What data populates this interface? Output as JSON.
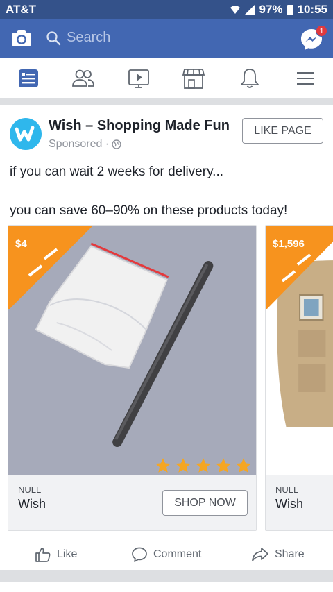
{
  "status": {
    "carrier": "AT&T",
    "battery": "97%",
    "time": "10:55"
  },
  "search": {
    "placeholder": "Search"
  },
  "messenger": {
    "badge": "1"
  },
  "nav": [
    "news-feed",
    "friends",
    "watch",
    "marketplace",
    "notifications",
    "menu"
  ],
  "post": {
    "page_name": "Wish – Shopping Made Fun",
    "sponsored": "Sponsored ·",
    "like_page": "LIKE PAGE",
    "text_line1": "if you can wait 2 weeks for delivery...",
    "text_line2": "you can save 60–90% on these products today!"
  },
  "carousel": [
    {
      "price": "$4",
      "domain": "NULL",
      "name": "Wish",
      "cta": "SHOP NOW",
      "rating": 5
    },
    {
      "price": "$1,596",
      "domain": "NULL",
      "name": "Wish"
    }
  ],
  "actions": {
    "like": "Like",
    "comment": "Comment",
    "share": "Share"
  },
  "colors": {
    "brand": "#4267b2",
    "statusbar": "#34528a",
    "tag": "#f7931e",
    "star": "#f5a623"
  }
}
